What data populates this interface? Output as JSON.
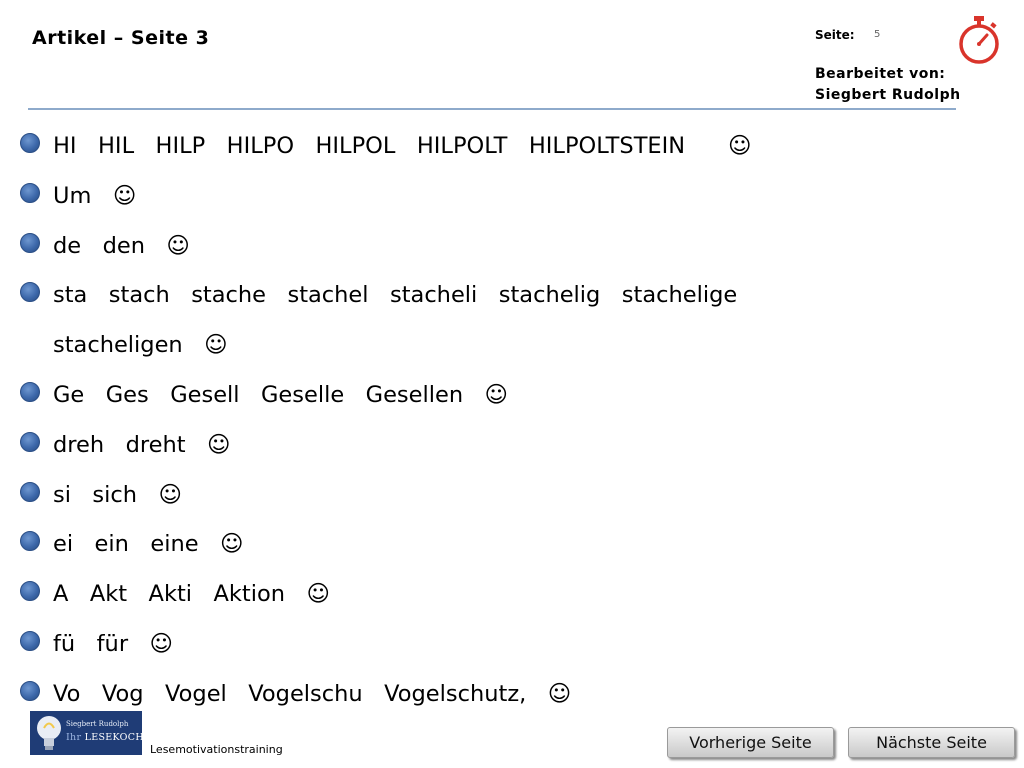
{
  "header": {
    "title": "Artikel – Seite 3",
    "page_label": "Seite:",
    "page_number": "5",
    "editor_label": "Bearbeitet von:",
    "editor_name": "Siegbert Rudolph"
  },
  "lines": [
    {
      "text": "HI   HIL   HILP   HILPO   HILPOL   HILPOLT   HILPOLTSTEIN      ☺",
      "bullet": true
    },
    {
      "text": "Um   ☺",
      "bullet": true
    },
    {
      "text": "de   den   ☺",
      "bullet": true
    },
    {
      "text": "sta   stach   stache   stachel   stacheli   stachelig   stachelige",
      "bullet": true
    },
    {
      "text": "stacheligen   ☺",
      "bullet": false
    },
    {
      "text": "Ge   Ges   Gesell   Geselle   Gesellen   ☺",
      "bullet": true
    },
    {
      "text": "dreh   dreht   ☺",
      "bullet": true
    },
    {
      "text": "si   sich   ☺",
      "bullet": true
    },
    {
      "text": "ei   ein   eine   ☺",
      "bullet": true
    },
    {
      "text": "A   Akt   Akti   Aktion   ☺",
      "bullet": true
    },
    {
      "text": "fü   für   ☺",
      "bullet": true
    },
    {
      "text": "Vo   Vog   Vogel   Vogelschu   Vogelschutz,   ☺",
      "bullet": true
    }
  ],
  "footer": {
    "logo_author": "Siegbert Rudolph",
    "logo_brand_prefix": "Ihr",
    "logo_brand": "LESEKOCH",
    "caption": "Lesemotivationstraining"
  },
  "nav": {
    "prev_label": "Vorherige Seite",
    "next_label": "Nächste Seite"
  },
  "colors": {
    "accent_line": "#8eaacb",
    "bullet": "#3d68aa",
    "timer": "#d9342b",
    "logo_bg": "#1f3c76"
  },
  "icons": {
    "timer": "stopwatch-icon",
    "bullet": "bullet-dot-icon",
    "logo": "lightbulb-logo"
  }
}
